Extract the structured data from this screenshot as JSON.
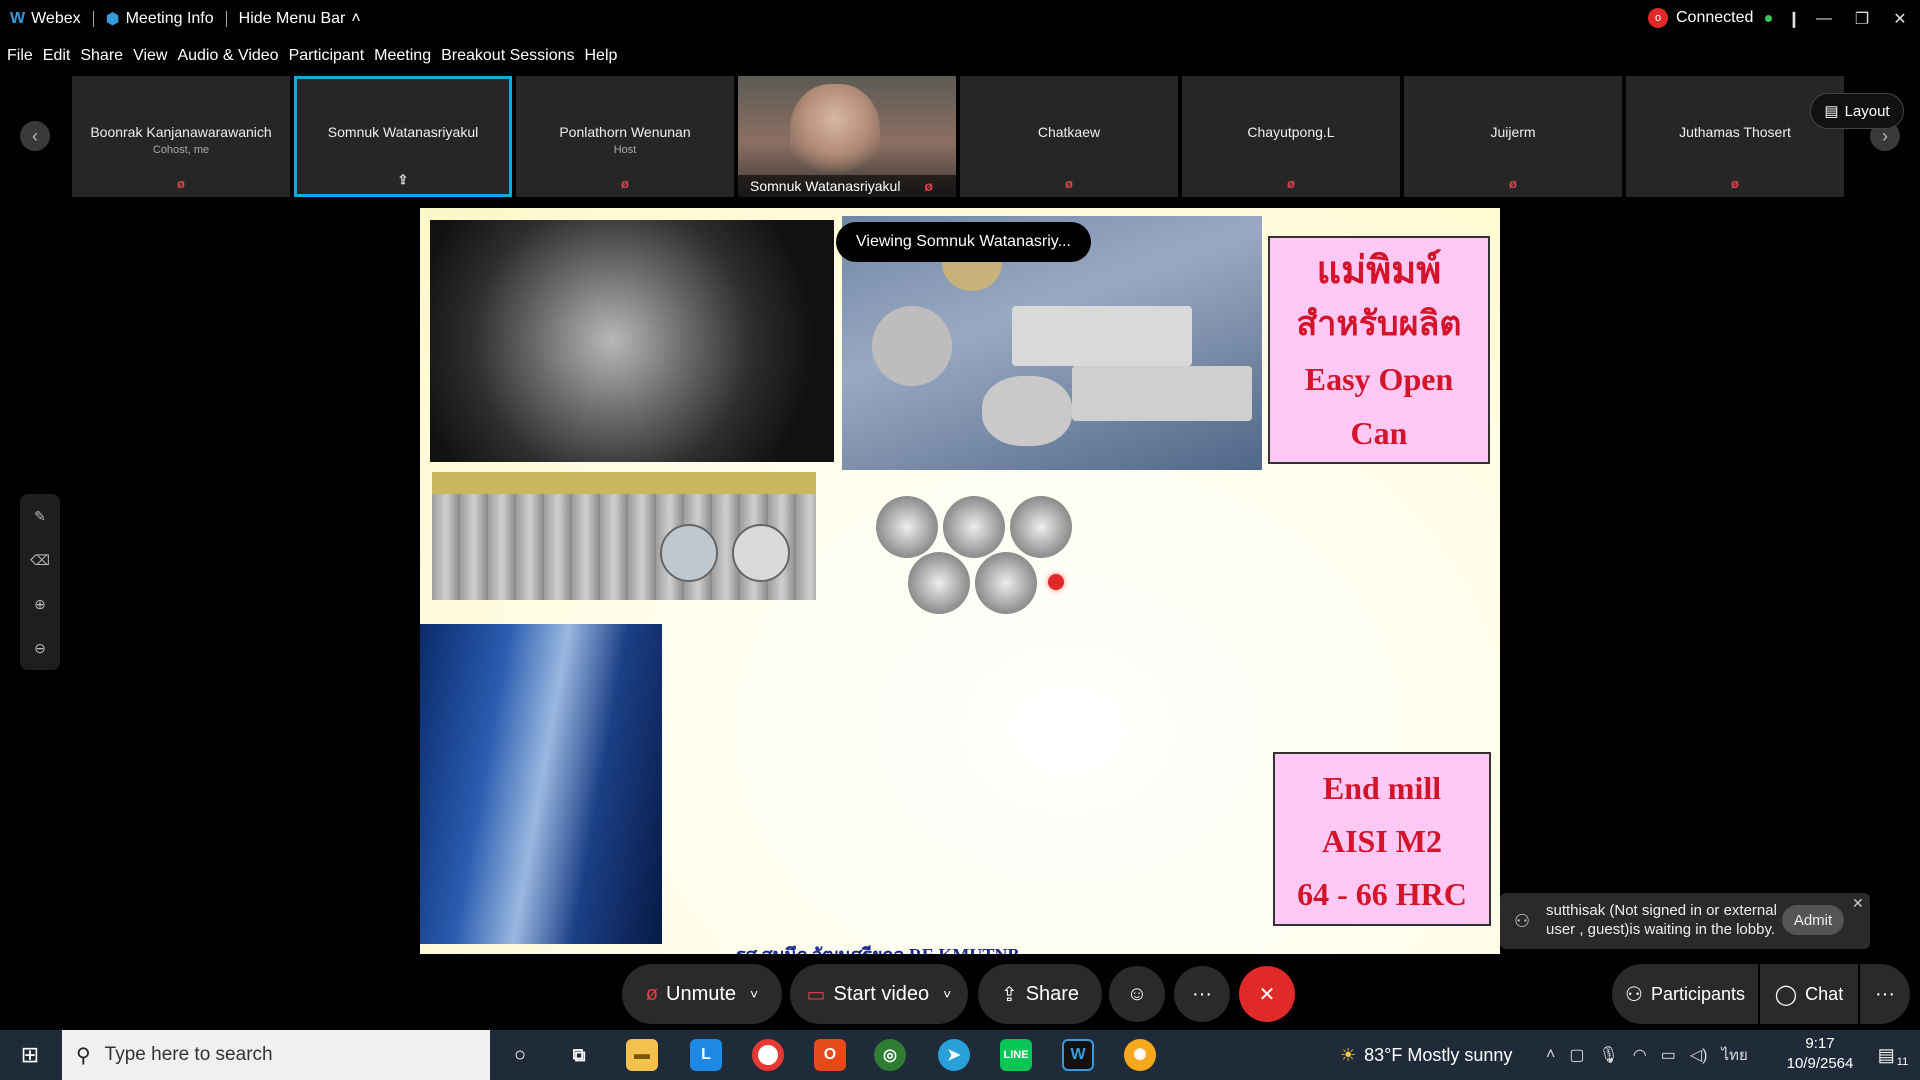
{
  "titlebar": {
    "app_name": "Webex",
    "meeting_info": "Meeting Info",
    "hide_menu": "Hide Menu Bar",
    "connection": "Connected"
  },
  "menu": [
    "File",
    "Edit",
    "Share",
    "View",
    "Audio & Video",
    "Participant",
    "Meeting",
    "Breakout Sessions",
    "Help"
  ],
  "participants": [
    {
      "name": "Boonrak Kanjanawarawanich",
      "role": "Cohost, me"
    },
    {
      "name": "Somnuk Watanasriyakul",
      "role": ""
    },
    {
      "name": "Ponlathorn Wenunan",
      "role": "Host"
    },
    {
      "name": "Somnuk Watanasriyakul",
      "role": ""
    },
    {
      "name": "Chatkaew",
      "role": ""
    },
    {
      "name": "Chayutpong.L",
      "role": ""
    },
    {
      "name": "Juijerm",
      "role": ""
    },
    {
      "name": "Juthamas Thosert",
      "role": ""
    }
  ],
  "layout_button": "Layout",
  "viewing_label": "Viewing Somnuk Watanasriy...",
  "slide": {
    "box1_lines": [
      "แม่พิมพ์",
      "สำหรับผลิต",
      "Easy Open",
      "Can"
    ],
    "box2_lines": [
      "End mill",
      "AISI M2",
      "64 - 66 HRC"
    ],
    "footer": "รศ.สมนึก วัฒนศรียกุล RE KMUTNB"
  },
  "controls": {
    "unmute": "Unmute",
    "start_video": "Start video",
    "share": "Share",
    "participants": "Participants",
    "chat": "Chat"
  },
  "notification": {
    "text": "sutthisak (Not signed in or external user , guest)is waiting in the lobby.",
    "admit": "Admit"
  },
  "taskbar": {
    "search_placeholder": "Type here to search",
    "weather": "83°F  Mostly sunny",
    "lang": "ไทย",
    "time": "9:17",
    "date": "10/9/2564",
    "notif_count": "11"
  },
  "colors": {
    "accent": "#1aa6e3",
    "end_call": "#e02a2a",
    "slide_text": "#d4142a",
    "slide_box": "#ffc8f5"
  }
}
